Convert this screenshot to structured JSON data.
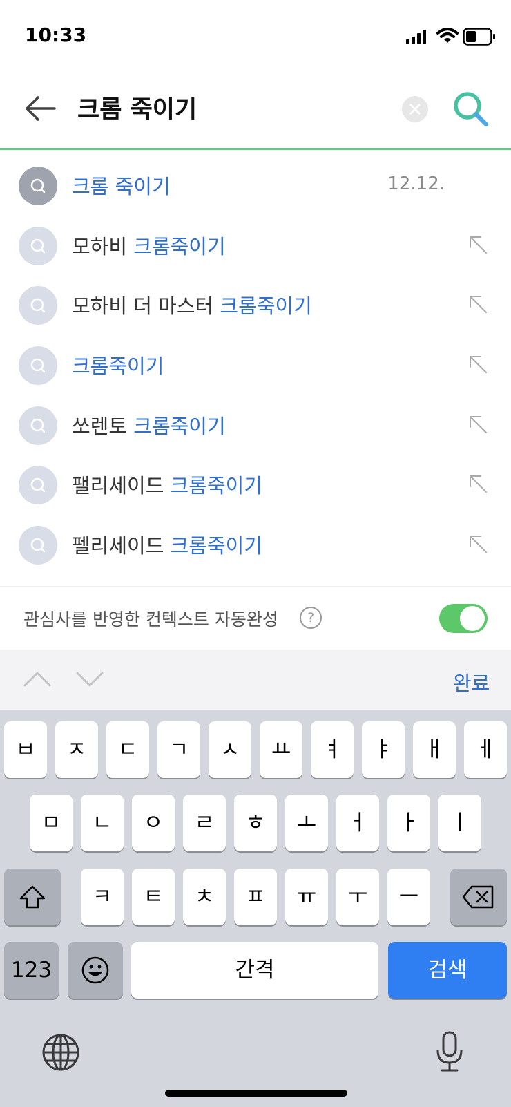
{
  "status_bar": {
    "time": "10:33"
  },
  "search": {
    "query": "크롬 죽이기"
  },
  "suggestions": [
    {
      "type": "recent",
      "plain": "",
      "highlight": "크롬 죽이기",
      "date": "12.12."
    },
    {
      "type": "suggest",
      "plain": "모하비 ",
      "highlight": "크롬죽이기"
    },
    {
      "type": "suggest",
      "plain": "모하비 더 마스터 ",
      "highlight": "크롬죽이기"
    },
    {
      "type": "suggest",
      "plain": "",
      "highlight": "크롬죽이기"
    },
    {
      "type": "suggest",
      "plain": "쏘렌토 ",
      "highlight": "크롬죽이기"
    },
    {
      "type": "suggest",
      "plain": "팰리세이드 ",
      "highlight": "크롬죽이기"
    },
    {
      "type": "suggest",
      "plain": "펠리세이드 ",
      "highlight": "크롬죽이기"
    }
  ],
  "context_autocomplete": {
    "label": "관심사를 반영한 컨텍스트 자동완성",
    "help": "?",
    "enabled": true
  },
  "keyboard": {
    "done_label": "완료",
    "row1": [
      "ㅂ",
      "ㅈ",
      "ㄷ",
      "ㄱ",
      "ㅅ",
      "ㅛ",
      "ㅕ",
      "ㅑ",
      "ㅐ",
      "ㅔ"
    ],
    "row2": [
      "ㅁ",
      "ㄴ",
      "ㅇ",
      "ㄹ",
      "ㅎ",
      "ㅗ",
      "ㅓ",
      "ㅏ",
      "ㅣ"
    ],
    "row3": [
      "ㅋ",
      "ㅌ",
      "ㅊ",
      "ㅍ",
      "ㅠ",
      "ㅜ",
      "ㅡ"
    ],
    "numbers_label": "123",
    "space_label": "간격",
    "search_label": "검색"
  },
  "colors": {
    "accent": "#2f6fd1",
    "brand_green": "#5cc86a",
    "search_key": "#2f7ef2"
  },
  "icons": [
    "back-arrow-icon",
    "clear-icon",
    "search-icon",
    "fill-arrow-icon",
    "shift-icon",
    "backspace-icon",
    "emoji-icon",
    "globe-icon",
    "microphone-icon"
  ]
}
